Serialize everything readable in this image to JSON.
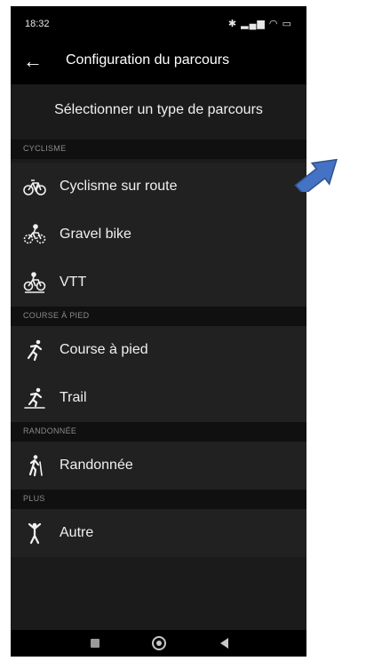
{
  "status_bar": {
    "time": "18:32",
    "icons": [
      "bluetooth-icon",
      "signal-icon",
      "wifi-icon",
      "battery-icon"
    ]
  },
  "app_bar": {
    "back_icon": "arrow-left-icon",
    "title": "Configuration du parcours"
  },
  "heading": "Sélectionner un type de parcours",
  "sections": [
    {
      "label": "CYCLISME",
      "items": [
        {
          "label": "Cyclisme sur route",
          "icon": "road-bike-icon"
        },
        {
          "label": "Gravel bike",
          "icon": "gravel-bike-icon"
        },
        {
          "label": "VTT",
          "icon": "mountain-bike-icon"
        }
      ]
    },
    {
      "label": "COURSE À PIED",
      "items": [
        {
          "label": "Course à pied",
          "icon": "running-icon"
        },
        {
          "label": "Trail",
          "icon": "trail-running-icon"
        }
      ]
    },
    {
      "label": "RANDONNÉE",
      "items": [
        {
          "label": "Randonnée",
          "icon": "hiking-icon"
        }
      ]
    },
    {
      "label": "PLUS",
      "items": [
        {
          "label": "Autre",
          "icon": "other-activity-icon"
        }
      ]
    }
  ],
  "nav_bar": {
    "buttons": [
      "recent-apps-icon",
      "home-icon",
      "back-icon"
    ]
  },
  "annotation": {
    "arrow_color": "#4472c4"
  },
  "colors": {
    "background": "#1b1b1b",
    "item_background": "#212121",
    "section_background": "#101010",
    "text": "#f0f0f0"
  }
}
